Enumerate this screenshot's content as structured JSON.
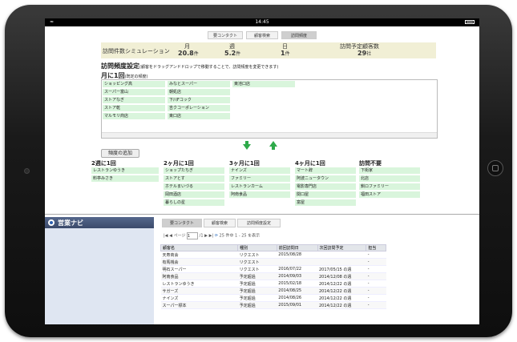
{
  "status_bar": {
    "time": "14:45"
  },
  "top_tabs": [
    "要コンタクト",
    "顧客検索",
    "訪問頻度"
  ],
  "summary": {
    "title": "訪問件数シミュレーション",
    "month_label": "月",
    "month_value": "20.8",
    "month_unit": "件",
    "week_label": "週",
    "week_value": "5.2",
    "week_unit": "件",
    "day_label": "日",
    "day_value": "1",
    "day_unit": "件",
    "planned_label": "訪問予定顧客数",
    "planned_value": "29",
    "planned_unit": "社"
  },
  "frequency": {
    "title": "訪問頻度設定",
    "hint": "(顧客をドラッグアンドドロップで移動することで、訪問頻度を変更できます)",
    "monthly_title": "月に1回",
    "monthly_sub": "(既定の頻度)",
    "monthly_col1": [
      "ショッピング高",
      "スーパー富山",
      "ストアなぎ",
      "ストア乾",
      "マルモリ商店"
    ],
    "monthly_col2": [
      "みなとスーパー",
      "朝処店",
      "下川Fコック",
      "吉クコーポレーション",
      "東口店"
    ],
    "monthly_col3": [
      "東池口店"
    ],
    "add_button": "頻度の追加",
    "columns": [
      {
        "title": "2週に1回",
        "items": [
          "レストランゆうき",
          "料亭みさき"
        ]
      },
      {
        "title": "2ヶ月に1回",
        "items": [
          "ショップたちぎ",
          "ストアとす",
          "ホテルまいづる",
          "岡田酒店",
          "暮らしの星"
        ]
      },
      {
        "title": "3ヶ月に1回",
        "items": [
          "ナインズ",
          "ファミリー",
          "レストランカーム",
          "阿南食品"
        ]
      },
      {
        "title": "4ヶ月に1回",
        "items": [
          "マート辞",
          "阿波ニュータウン",
          "電影専門店",
          "関口屋",
          "富屋"
        ]
      },
      {
        "title": "訪問不要",
        "items": [
          "下街家",
          "北店",
          "釧ロファミリー",
          "福田ストア"
        ]
      }
    ]
  },
  "app": {
    "brand": "営業ナビ"
  },
  "lower_tabs": [
    "要コンタクト",
    "顧客検索",
    "訪問頻度設定"
  ],
  "pager": {
    "page_label": "ページ",
    "page_value": "1",
    "total": "/1",
    "summary": "25 件中 1 - 25 を表示"
  },
  "table": {
    "headers": [
      "顧客名",
      "種別",
      "前回訪問日",
      "次回訪問予定",
      "担当"
    ],
    "rows": [
      [
        "天寿商会",
        "リクエスト",
        "2015/08/28",
        "",
        "-"
      ],
      [
        "有馬桟会",
        "リクエスト",
        "",
        "",
        "-"
      ],
      [
        "明石スーパー",
        "リクエスト",
        "2016/07/22",
        "2017/05/15 の週",
        "-"
      ],
      [
        "阿南食品",
        "予定超過",
        "2014/09/03",
        "2014/12/08 の週",
        "-"
      ],
      [
        "レストランゆうき",
        "予定超過",
        "2015/02/18",
        "2014/12/22 の週",
        "-"
      ],
      [
        "サガーズ",
        "予定超過",
        "2014/08/25",
        "2014/12/22 の週",
        "-"
      ],
      [
        "ナインズ",
        "予定超過",
        "2014/08/26",
        "2014/12/22 の週",
        "-"
      ],
      [
        "スーパー標本",
        "予定超過",
        "2015/09/01",
        "2014/12/22 の週",
        "-"
      ]
    ]
  }
}
